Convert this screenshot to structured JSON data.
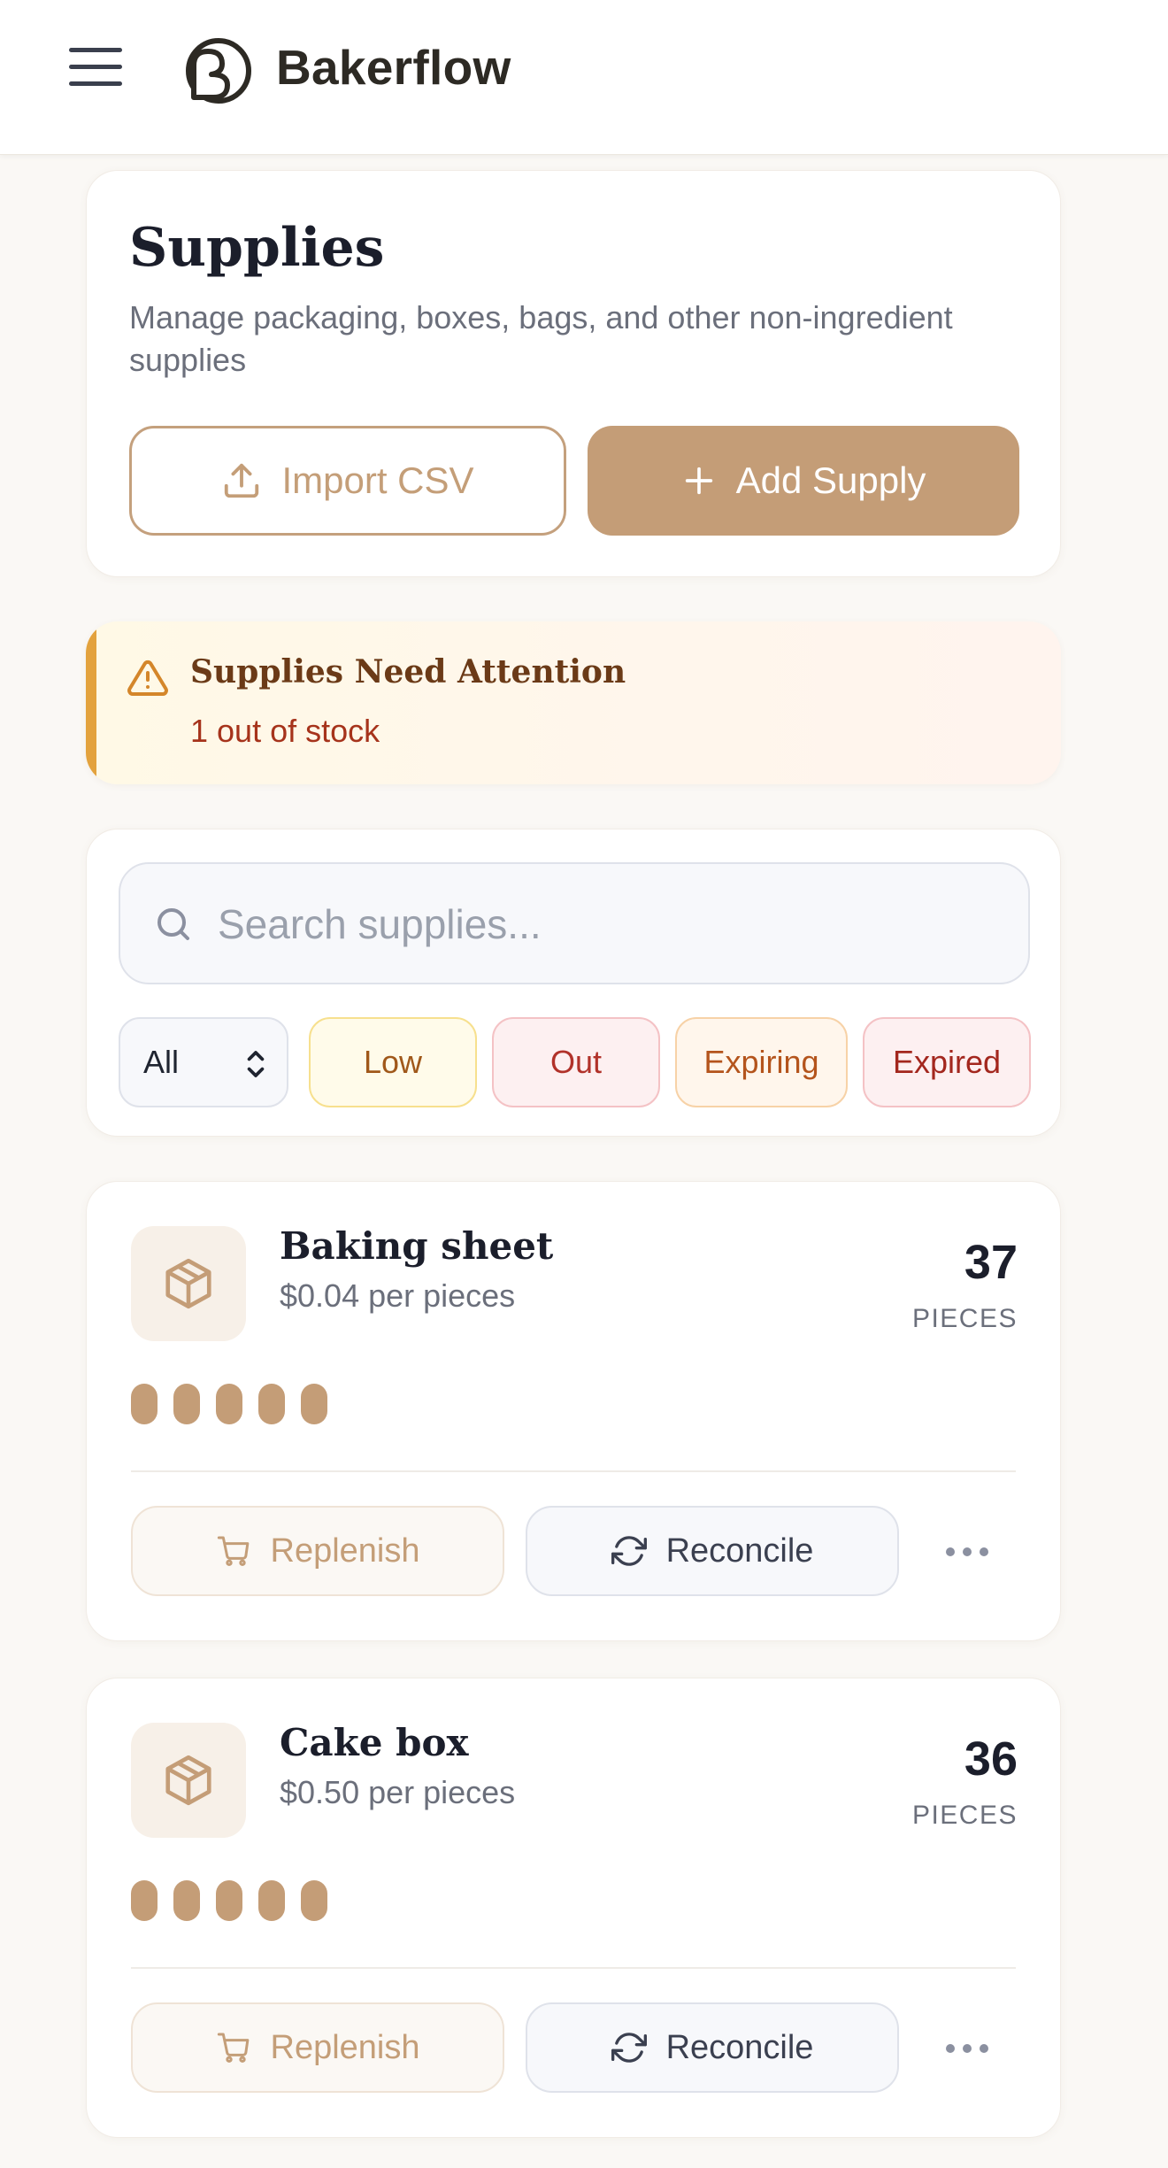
{
  "header": {
    "brand": "Bakerflow",
    "menu_icon": "menu-icon",
    "logo_icon": "bakerflow-logo"
  },
  "page": {
    "title": "Supplies",
    "subtitle": "Manage packaging, boxes, bags, and other non-ingredient supplies",
    "import_label": "Import CSV",
    "add_label": "Add Supply"
  },
  "alert": {
    "title": "Supplies Need Attention",
    "detail": "1 out of stock"
  },
  "search": {
    "placeholder": "Search supplies...",
    "value": ""
  },
  "filters": {
    "status_selected": "All",
    "chips": [
      "Low",
      "Out",
      "Expiring",
      "Expired"
    ]
  },
  "supplies": [
    {
      "name": "Baking sheet",
      "price": "$0.04 per pieces",
      "quantity": "37",
      "unit": "PIECES",
      "stock_level": 5,
      "replenish_label": "Replenish",
      "reconcile_label": "Reconcile"
    },
    {
      "name": "Cake box",
      "price": "$0.50 per pieces",
      "quantity": "36",
      "unit": "PIECES",
      "stock_level": 5,
      "replenish_label": "Replenish",
      "reconcile_label": "Reconcile"
    }
  ],
  "colors": {
    "accent": "#c49d77",
    "warning": "#e3a23d",
    "danger": "#a6331b",
    "background": "#faf8f5"
  }
}
